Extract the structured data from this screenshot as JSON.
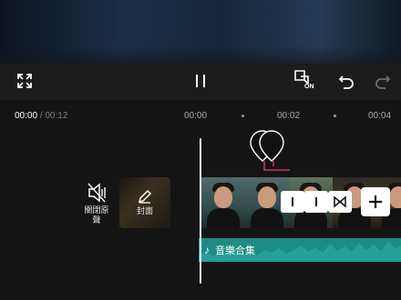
{
  "playback": {
    "current_time": "00:00",
    "separator": "/",
    "total_time": "00:12"
  },
  "timeline": {
    "ticks": [
      "00:00",
      "00:02",
      "00:04"
    ]
  },
  "tools": {
    "mute_label_line1": "關閉原",
    "mute_label_line2": "聲",
    "cover_label": "封面"
  },
  "audio": {
    "title": "音樂合集",
    "note_icon": "♪"
  },
  "controls": {
    "fullscreen_icon": "expand-icon",
    "pause_icon": "pause-icon",
    "keyframe_badge": "ON",
    "undo_icon": "undo-icon",
    "redo_icon": "redo-icon"
  },
  "colors": {
    "audio_track": "#1d8c85",
    "marker_accent": "#e0466b",
    "background": "#141414"
  }
}
